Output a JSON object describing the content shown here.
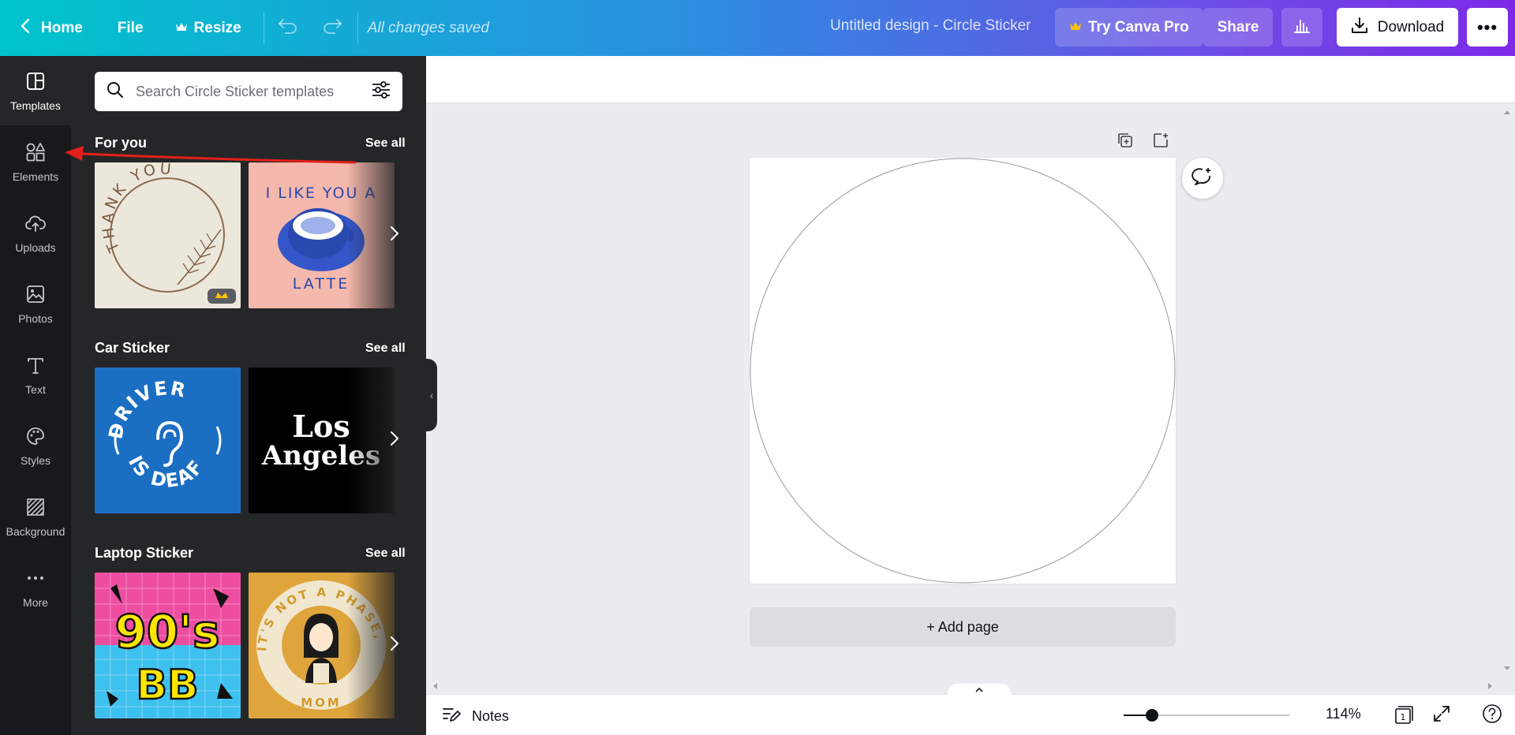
{
  "topbar": {
    "home_label": "Home",
    "file_label": "File",
    "resize_label": "Resize",
    "saved_status": "All changes saved",
    "design_title": "Untitled design - Circle Sticker",
    "pro_label": "Try Canva Pro",
    "share_label": "Share",
    "download_label": "Download"
  },
  "rail": {
    "items": [
      {
        "label": "Templates",
        "icon": "templates-icon"
      },
      {
        "label": "Elements",
        "icon": "elements-icon"
      },
      {
        "label": "Uploads",
        "icon": "upload-cloud-icon"
      },
      {
        "label": "Photos",
        "icon": "image-icon"
      },
      {
        "label": "Text",
        "icon": "text-icon"
      },
      {
        "label": "Styles",
        "icon": "palette-icon"
      },
      {
        "label": "Background",
        "icon": "background-hatch-icon"
      },
      {
        "label": "More",
        "icon": "more-dots-icon"
      }
    ]
  },
  "panel": {
    "search_placeholder": "Search Circle Sticker templates",
    "sections": [
      {
        "title": "For you",
        "see_all": "See all",
        "templates": [
          {
            "text": "THANK YOU",
            "bg": "#ece7db",
            "premium": true
          },
          {
            "text": "I LIKE YOU A LATTE",
            "bg": "#f5b8ac",
            "premium": false
          }
        ]
      },
      {
        "title": "Car Sticker",
        "see_all": "See all",
        "templates": [
          {
            "text": "DRIVER IS DEAF",
            "bg": "#1b6fc3",
            "premium": false
          },
          {
            "text": "Los Angeles",
            "bg": "#000000",
            "premium": false
          }
        ]
      },
      {
        "title": "Laptop Sticker",
        "see_all": "See all",
        "templates": [
          {
            "text": "90's BB",
            "bg": "#ee4ea0",
            "premium": false
          },
          {
            "text": "IT'S NOT A PHASE, MOM",
            "bg": "#dfa53c",
            "premium": false
          }
        ]
      }
    ]
  },
  "canvas": {
    "add_page_label": "+ Add page"
  },
  "bottombar": {
    "notes_label": "Notes",
    "zoom_value": "114%",
    "zoom_fraction": 0.17,
    "page_count": "1"
  },
  "colors": {
    "gradient_start": "#00c4cc",
    "gradient_end": "#7d2ae8",
    "panel_bg": "#252627",
    "rail_bg": "#18191b",
    "annotation_arrow": "#e3201b",
    "crown": "#ffc107"
  }
}
